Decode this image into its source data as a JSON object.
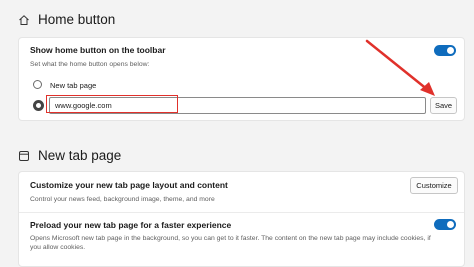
{
  "home_button": {
    "title": "Home button",
    "icon": "home-icon",
    "show_label": "Show home button on the toolbar",
    "show_sub": "Set what the home button opens below:",
    "show_enabled": true,
    "option_new_tab": "New tab page",
    "url_value": "www.google.com",
    "save_label": "Save"
  },
  "new_tab_page": {
    "title": "New tab page",
    "icon": "new-tab-icon",
    "customize_title": "Customize your new tab page layout and content",
    "customize_sub": "Control your news feed, background image, theme, and more",
    "customize_button": "Customize",
    "preload_title": "Preload your new tab page for a faster experience",
    "preload_sub": "Opens Microsoft new tab page in the background, so you can get to it faster. The content on the new tab page may include cookies, if you allow cookies.",
    "preload_enabled": true
  },
  "colors": {
    "accent": "#0f6cbd",
    "annotation": "#e0312b"
  }
}
